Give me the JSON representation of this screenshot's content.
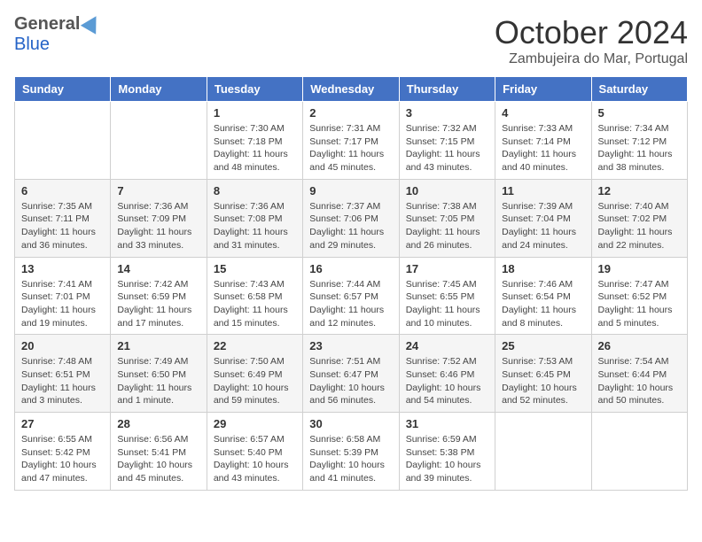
{
  "header": {
    "logo_general": "General",
    "logo_blue": "Blue",
    "month_title": "October 2024",
    "location": "Zambujeira do Mar, Portugal"
  },
  "days_of_week": [
    "Sunday",
    "Monday",
    "Tuesday",
    "Wednesday",
    "Thursday",
    "Friday",
    "Saturday"
  ],
  "weeks": [
    [
      {
        "day": "",
        "sunrise": "",
        "sunset": "",
        "daylight": ""
      },
      {
        "day": "",
        "sunrise": "",
        "sunset": "",
        "daylight": ""
      },
      {
        "day": "1",
        "sunrise": "Sunrise: 7:30 AM",
        "sunset": "Sunset: 7:18 PM",
        "daylight": "Daylight: 11 hours and 48 minutes."
      },
      {
        "day": "2",
        "sunrise": "Sunrise: 7:31 AM",
        "sunset": "Sunset: 7:17 PM",
        "daylight": "Daylight: 11 hours and 45 minutes."
      },
      {
        "day": "3",
        "sunrise": "Sunrise: 7:32 AM",
        "sunset": "Sunset: 7:15 PM",
        "daylight": "Daylight: 11 hours and 43 minutes."
      },
      {
        "day": "4",
        "sunrise": "Sunrise: 7:33 AM",
        "sunset": "Sunset: 7:14 PM",
        "daylight": "Daylight: 11 hours and 40 minutes."
      },
      {
        "day": "5",
        "sunrise": "Sunrise: 7:34 AM",
        "sunset": "Sunset: 7:12 PM",
        "daylight": "Daylight: 11 hours and 38 minutes."
      }
    ],
    [
      {
        "day": "6",
        "sunrise": "Sunrise: 7:35 AM",
        "sunset": "Sunset: 7:11 PM",
        "daylight": "Daylight: 11 hours and 36 minutes."
      },
      {
        "day": "7",
        "sunrise": "Sunrise: 7:36 AM",
        "sunset": "Sunset: 7:09 PM",
        "daylight": "Daylight: 11 hours and 33 minutes."
      },
      {
        "day": "8",
        "sunrise": "Sunrise: 7:36 AM",
        "sunset": "Sunset: 7:08 PM",
        "daylight": "Daylight: 11 hours and 31 minutes."
      },
      {
        "day": "9",
        "sunrise": "Sunrise: 7:37 AM",
        "sunset": "Sunset: 7:06 PM",
        "daylight": "Daylight: 11 hours and 29 minutes."
      },
      {
        "day": "10",
        "sunrise": "Sunrise: 7:38 AM",
        "sunset": "Sunset: 7:05 PM",
        "daylight": "Daylight: 11 hours and 26 minutes."
      },
      {
        "day": "11",
        "sunrise": "Sunrise: 7:39 AM",
        "sunset": "Sunset: 7:04 PM",
        "daylight": "Daylight: 11 hours and 24 minutes."
      },
      {
        "day": "12",
        "sunrise": "Sunrise: 7:40 AM",
        "sunset": "Sunset: 7:02 PM",
        "daylight": "Daylight: 11 hours and 22 minutes."
      }
    ],
    [
      {
        "day": "13",
        "sunrise": "Sunrise: 7:41 AM",
        "sunset": "Sunset: 7:01 PM",
        "daylight": "Daylight: 11 hours and 19 minutes."
      },
      {
        "day": "14",
        "sunrise": "Sunrise: 7:42 AM",
        "sunset": "Sunset: 6:59 PM",
        "daylight": "Daylight: 11 hours and 17 minutes."
      },
      {
        "day": "15",
        "sunrise": "Sunrise: 7:43 AM",
        "sunset": "Sunset: 6:58 PM",
        "daylight": "Daylight: 11 hours and 15 minutes."
      },
      {
        "day": "16",
        "sunrise": "Sunrise: 7:44 AM",
        "sunset": "Sunset: 6:57 PM",
        "daylight": "Daylight: 11 hours and 12 minutes."
      },
      {
        "day": "17",
        "sunrise": "Sunrise: 7:45 AM",
        "sunset": "Sunset: 6:55 PM",
        "daylight": "Daylight: 11 hours and 10 minutes."
      },
      {
        "day": "18",
        "sunrise": "Sunrise: 7:46 AM",
        "sunset": "Sunset: 6:54 PM",
        "daylight": "Daylight: 11 hours and 8 minutes."
      },
      {
        "day": "19",
        "sunrise": "Sunrise: 7:47 AM",
        "sunset": "Sunset: 6:52 PM",
        "daylight": "Daylight: 11 hours and 5 minutes."
      }
    ],
    [
      {
        "day": "20",
        "sunrise": "Sunrise: 7:48 AM",
        "sunset": "Sunset: 6:51 PM",
        "daylight": "Daylight: 11 hours and 3 minutes."
      },
      {
        "day": "21",
        "sunrise": "Sunrise: 7:49 AM",
        "sunset": "Sunset: 6:50 PM",
        "daylight": "Daylight: 11 hours and 1 minute."
      },
      {
        "day": "22",
        "sunrise": "Sunrise: 7:50 AM",
        "sunset": "Sunset: 6:49 PM",
        "daylight": "Daylight: 10 hours and 59 minutes."
      },
      {
        "day": "23",
        "sunrise": "Sunrise: 7:51 AM",
        "sunset": "Sunset: 6:47 PM",
        "daylight": "Daylight: 10 hours and 56 minutes."
      },
      {
        "day": "24",
        "sunrise": "Sunrise: 7:52 AM",
        "sunset": "Sunset: 6:46 PM",
        "daylight": "Daylight: 10 hours and 54 minutes."
      },
      {
        "day": "25",
        "sunrise": "Sunrise: 7:53 AM",
        "sunset": "Sunset: 6:45 PM",
        "daylight": "Daylight: 10 hours and 52 minutes."
      },
      {
        "day": "26",
        "sunrise": "Sunrise: 7:54 AM",
        "sunset": "Sunset: 6:44 PM",
        "daylight": "Daylight: 10 hours and 50 minutes."
      }
    ],
    [
      {
        "day": "27",
        "sunrise": "Sunrise: 6:55 AM",
        "sunset": "Sunset: 5:42 PM",
        "daylight": "Daylight: 10 hours and 47 minutes."
      },
      {
        "day": "28",
        "sunrise": "Sunrise: 6:56 AM",
        "sunset": "Sunset: 5:41 PM",
        "daylight": "Daylight: 10 hours and 45 minutes."
      },
      {
        "day": "29",
        "sunrise": "Sunrise: 6:57 AM",
        "sunset": "Sunset: 5:40 PM",
        "daylight": "Daylight: 10 hours and 43 minutes."
      },
      {
        "day": "30",
        "sunrise": "Sunrise: 6:58 AM",
        "sunset": "Sunset: 5:39 PM",
        "daylight": "Daylight: 10 hours and 41 minutes."
      },
      {
        "day": "31",
        "sunrise": "Sunrise: 6:59 AM",
        "sunset": "Sunset: 5:38 PM",
        "daylight": "Daylight: 10 hours and 39 minutes."
      },
      {
        "day": "",
        "sunrise": "",
        "sunset": "",
        "daylight": ""
      },
      {
        "day": "",
        "sunrise": "",
        "sunset": "",
        "daylight": ""
      }
    ]
  ]
}
